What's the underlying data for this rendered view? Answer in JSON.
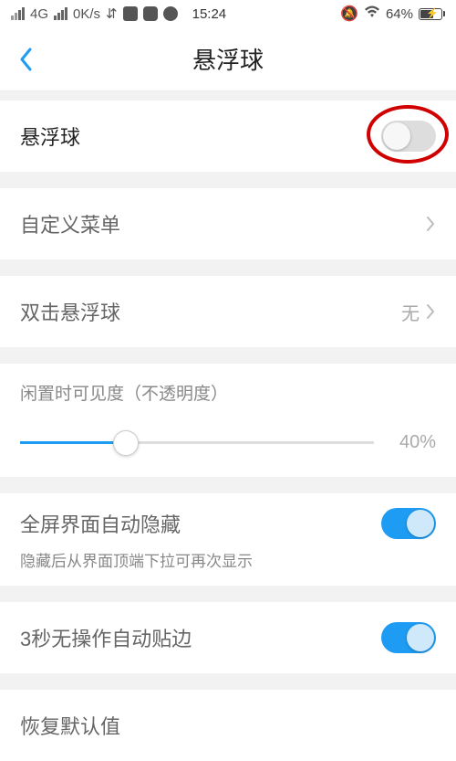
{
  "status": {
    "network": "4G",
    "speed": "0K/s",
    "usb": "⇵",
    "time": "15:24",
    "battery_pct": "64%"
  },
  "nav": {
    "title": "悬浮球"
  },
  "rows": {
    "floating_ball": {
      "label": "悬浮球",
      "enabled": false
    },
    "custom_menu": {
      "label": "自定义菜单"
    },
    "double_tap": {
      "label": "双击悬浮球",
      "value": "无"
    },
    "opacity": {
      "label": "闲置时可见度（不透明度）",
      "value": 40,
      "display": "40%"
    },
    "auto_hide": {
      "label": "全屏界面自动隐藏",
      "sub": "隐藏后从界面顶端下拉可再次显示",
      "enabled": true
    },
    "auto_dock": {
      "label": "3秒无操作自动贴边",
      "enabled": true
    },
    "reset": {
      "label": "恢复默认值"
    }
  }
}
